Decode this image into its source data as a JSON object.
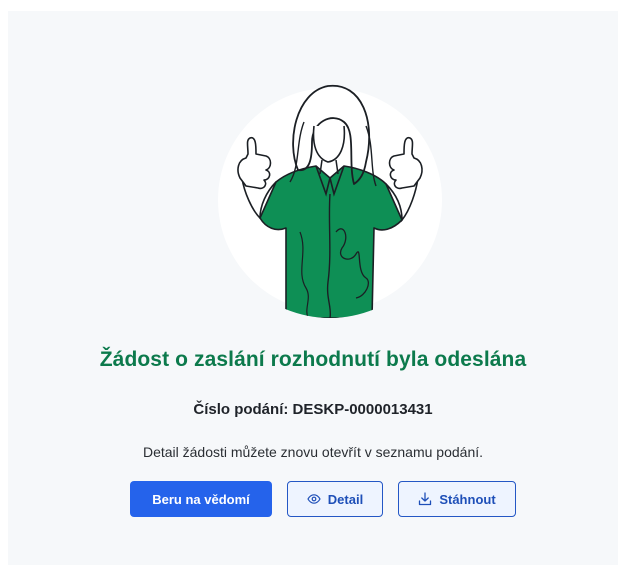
{
  "confirmation": {
    "title": "Žádost o zaslání rozhodnutí byla odeslána",
    "submission_number": "Číslo podání: DESKP-0000013431",
    "info": "Detail žádosti můžete znovu otevřít v seznamu podání."
  },
  "actions": {
    "acknowledge_label": "Beru na vědomí",
    "detail_label": "Detail",
    "download_label": "Stáhnout"
  },
  "icons": {
    "detail": "eye-icon",
    "download": "download-icon"
  },
  "colors": {
    "accent_green": "#0c7a4c",
    "primary_blue": "#2563eb",
    "outline_blue": "#1e4fb8"
  }
}
